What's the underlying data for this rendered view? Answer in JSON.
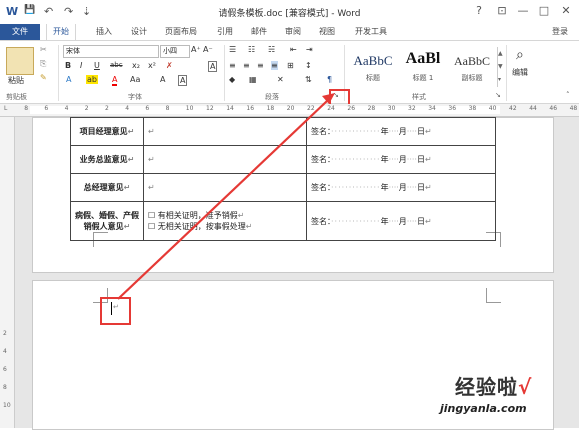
{
  "window": {
    "title": "请假条模板.doc [兼容模式] - Word",
    "help": "?",
    "ribbon_options": "⊡",
    "minimize": "—",
    "restore": "□",
    "close": "✕",
    "login": "登录"
  },
  "quick_access": {
    "word_icon": "W",
    "save_icon": "💾",
    "undo_icon": "↶",
    "redo_icon": "↷",
    "customize_icon": "⇣"
  },
  "tabs": [
    "文件",
    "开始",
    "插入",
    "设计",
    "页面布局",
    "引用",
    "邮件",
    "审阅",
    "视图",
    "开发工具"
  ],
  "ribbon": {
    "clipboard": {
      "label": "剪贴板",
      "paste": "粘贴"
    },
    "font": {
      "label": "字体",
      "name": "宋体",
      "size": "小四",
      "grow": "A⁺",
      "shrink": "A⁻",
      "case": "Aa",
      "clear": "A",
      "bold": "B",
      "italic": "I",
      "underline": "U",
      "strike": "abc",
      "sub": "x₂",
      "sup": "x²",
      "effects": "A",
      "highlight": "ab",
      "color": "A",
      "shade": "A",
      "border": "A"
    },
    "paragraph": {
      "label": "段落",
      "launcher": "↘"
    },
    "styles": {
      "label": "样式",
      "items": [
        {
          "sample": "AaBbC",
          "name": "标题"
        },
        {
          "sample": "AaBl",
          "name": "标题 1"
        },
        {
          "sample": "AaBbC",
          "name": "副标题"
        }
      ]
    },
    "editing": {
      "label": "编辑"
    }
  },
  "ruler": [
    "L",
    "8",
    "6",
    "4",
    "2",
    "2",
    "4",
    "6",
    "8",
    "10",
    "12",
    "14",
    "16",
    "18",
    "20",
    "22",
    "24",
    "26",
    "28",
    "30",
    "32",
    "34",
    "36",
    "38",
    "40",
    "42",
    "44",
    "46",
    "48"
  ],
  "vruler": [
    "2",
    "4",
    "6",
    "8",
    "10"
  ],
  "table": [
    {
      "label": "项目经理意见",
      "note": "",
      "sig": "签名：",
      "year": "年",
      "month": "月",
      "day": "日"
    },
    {
      "label": "业务总监意见",
      "note": "",
      "sig": "签名：",
      "year": "年",
      "month": "月",
      "day": "日"
    },
    {
      "label": "总经理意见",
      "note": "",
      "sig": "签名：",
      "year": "年",
      "month": "月",
      "day": "日"
    },
    {
      "label": "病假、婚假、产假销假人意见",
      "note": "",
      "sig": "签名：",
      "year": "年",
      "month": "月",
      "day": "日",
      "options": [
        "有相关证明，准予销假",
        "无相关证明，按事假处理"
      ]
    }
  ],
  "watermark": {
    "cn": "经验啦",
    "check": "√",
    "url": "jingyanla.com"
  }
}
